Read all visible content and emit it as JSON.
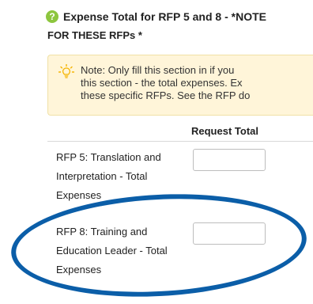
{
  "section": {
    "help_icon": "help-circle-icon",
    "title_line1": "Expense Total for RFP 5 and 8 - *NOTE",
    "title_line2": "FOR THESE RFPs *"
  },
  "note": {
    "icon": "lightbulb-icon",
    "line1": "Note: Only fill this section in if you",
    "line2": "this section - the total expenses. Ex",
    "line3": "these specific RFPs. See the RFP do"
  },
  "table": {
    "column_header": "Request Total",
    "rows": [
      {
        "label_lines": [
          "RFP 5: Translation and",
          "Interpretation - Total",
          "Expenses"
        ],
        "value": ""
      },
      {
        "label_lines": [
          "RFP 8: Training and",
          "Education Leader - Total",
          "Expenses"
        ],
        "value": ""
      }
    ]
  },
  "colors": {
    "help_icon": "#8dc63f",
    "note_background": "#fff5d9",
    "annotation_oval": "#0b5ea8"
  }
}
